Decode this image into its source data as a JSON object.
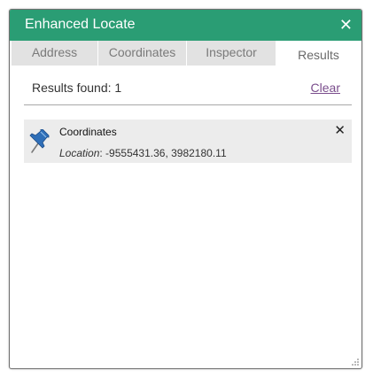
{
  "window": {
    "title": "Enhanced Locate",
    "close_icon": "close-icon",
    "accent_color": "#2a9d74"
  },
  "tabs": [
    {
      "label": "Address",
      "active": false
    },
    {
      "label": "Coordinates",
      "active": false
    },
    {
      "label": "Inspector",
      "active": false
    },
    {
      "label": "Results",
      "active": true
    }
  ],
  "results": {
    "summary": "Results found: 1",
    "clear_label": "Clear",
    "items": [
      {
        "icon": "push-pin-icon",
        "title": "Coordinates",
        "detail_label": "Location",
        "detail_sep": ":",
        "detail_value": " -9555431.36, 3982180.11",
        "remove_icon": "close-icon"
      }
    ]
  },
  "footer": {
    "resize_icon": "resize-grip-icon"
  }
}
